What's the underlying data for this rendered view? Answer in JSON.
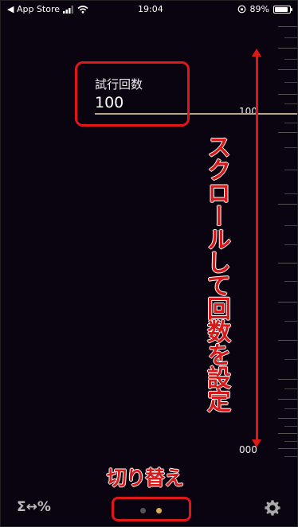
{
  "status_bar": {
    "back_app": "◀ App Store",
    "time": "19:04",
    "battery_percent": "89%",
    "battery_level": 0.89
  },
  "trial": {
    "label": "試行回数",
    "value": "100"
  },
  "ruler": {
    "top_value": "100",
    "bottom_value": "000"
  },
  "annotations": {
    "scroll_hint": "スクロールして回数を設定",
    "switch_hint": "切り替え"
  },
  "bottom_bar": {
    "stats_toggle": "Σ↔%",
    "page_count": 2,
    "current_page": 2
  },
  "colors": {
    "accent_red": "#e01717",
    "value_line": "#b9a58c",
    "active_dot": "#d9ae58",
    "background": "#0a0310"
  }
}
